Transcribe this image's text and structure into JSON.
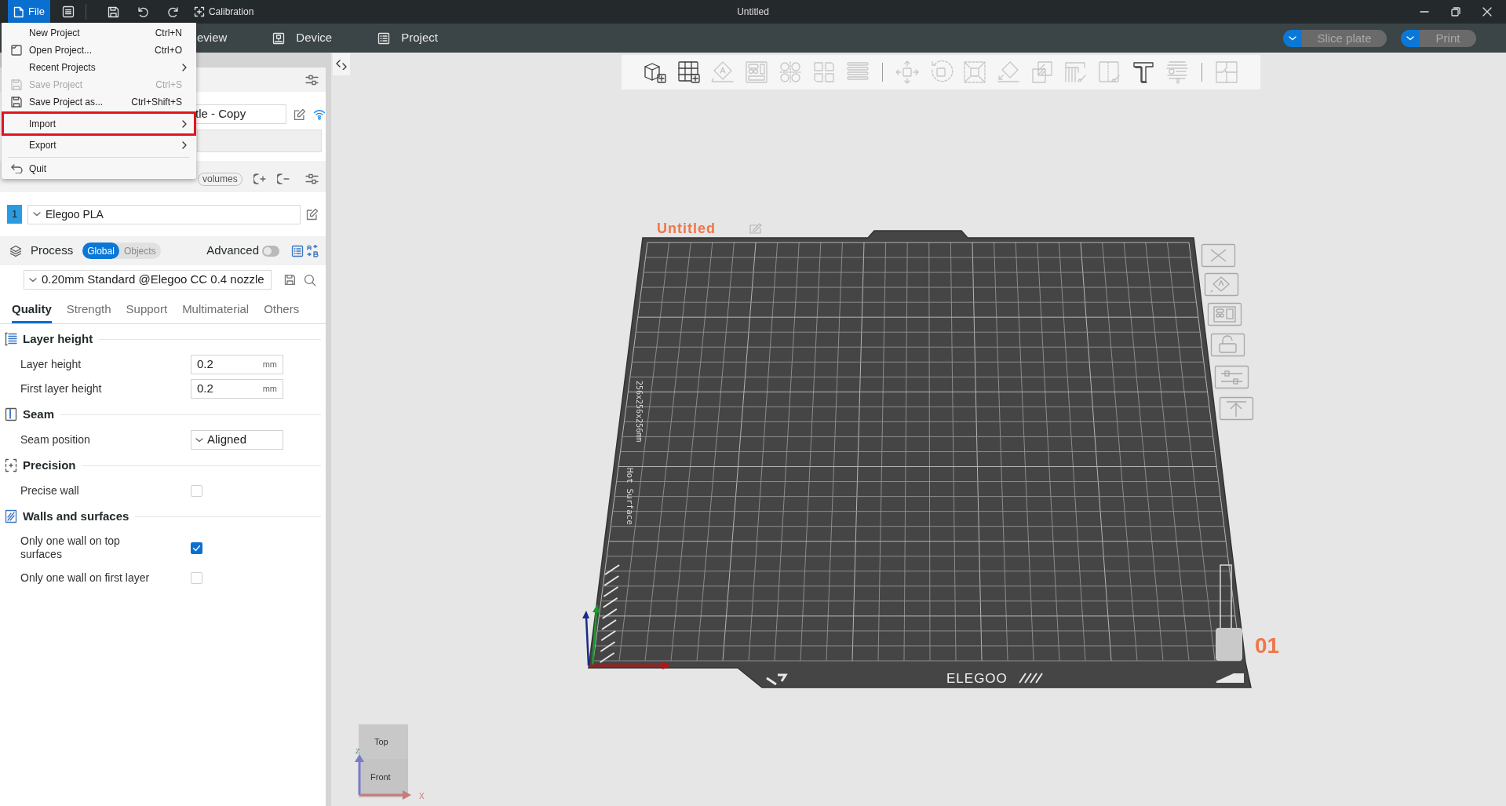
{
  "title_bar": {
    "file_label": "File",
    "calibration_label": "Calibration",
    "title": "Untitled"
  },
  "nav_tabs": [
    {
      "label": "eview",
      "selected": false
    },
    {
      "label": "Device",
      "selected": false
    },
    {
      "label": "Project",
      "selected": false
    }
  ],
  "action_buttons": [
    {
      "label": "Slice plate",
      "disabled": true
    },
    {
      "label": "Print",
      "disabled": true
    }
  ],
  "file_menu": [
    {
      "kind": "item",
      "label": "New Project",
      "shortcut": "Ctrl+N",
      "disabled": false,
      "submenu": false,
      "highlighted": false
    },
    {
      "kind": "item",
      "label": "Open Project...",
      "shortcut": "Ctrl+O",
      "disabled": false,
      "submenu": false,
      "highlighted": false
    },
    {
      "kind": "item",
      "label": "Recent Projects",
      "disabled": false,
      "submenu": true,
      "highlighted": false
    },
    {
      "kind": "item",
      "label": "Save Project",
      "shortcut": "Ctrl+S",
      "disabled": true,
      "submenu": false,
      "highlighted": false
    },
    {
      "kind": "item",
      "label": "Save Project as...",
      "shortcut": "Ctrl+Shift+S",
      "disabled": false,
      "submenu": false,
      "highlighted": false
    },
    {
      "kind": "item",
      "label": "Import",
      "disabled": false,
      "submenu": true,
      "highlighted": true
    },
    {
      "kind": "item",
      "label": "Export",
      "disabled": false,
      "submenu": true,
      "highlighted": false
    },
    {
      "kind": "separator"
    },
    {
      "kind": "item",
      "label": "Quit",
      "disabled": false,
      "submenu": false,
      "highlighted": false
    }
  ],
  "printer": {
    "name": "tle - Copy"
  },
  "filament": {
    "volumes_label": "volumes",
    "slots": [
      {
        "number": "1",
        "name": "Elegoo PLA",
        "color": "#2a9be0"
      }
    ]
  },
  "process": {
    "label": "Process",
    "scopes": [
      {
        "label": "Global",
        "selected": true
      },
      {
        "label": "Objects",
        "selected": false
      }
    ],
    "advanced_label": "Advanced",
    "advanced_on": false,
    "preset": "0.20mm Standard @Elegoo CC 0.4 nozzle",
    "tabs": [
      {
        "label": "Quality",
        "selected": true
      },
      {
        "label": "Strength",
        "selected": false
      },
      {
        "label": "Support",
        "selected": false
      },
      {
        "label": "Multimaterial",
        "selected": false
      },
      {
        "label": "Others",
        "selected": false
      }
    ],
    "sections": [
      {
        "title": "Layer height",
        "rows": [
          {
            "kind": "number",
            "label": "Layer height",
            "value": "0.2",
            "unit": "mm"
          },
          {
            "kind": "number",
            "label": "First layer height",
            "value": "0.2",
            "unit": "mm"
          }
        ]
      },
      {
        "title": "Seam",
        "rows": [
          {
            "kind": "select",
            "label": "Seam position",
            "value": "Aligned"
          }
        ]
      },
      {
        "title": "Precision",
        "rows": [
          {
            "kind": "checkbox",
            "label": "Precise wall",
            "checked": false
          }
        ]
      },
      {
        "title": "Walls and surfaces",
        "rows": [
          {
            "kind": "checkbox",
            "label": "Only one wall on top surfaces",
            "checked": true
          },
          {
            "kind": "checkbox",
            "label": "Only one wall on first layer",
            "checked": false
          }
        ]
      }
    ]
  },
  "plate": {
    "name": "Untitled",
    "number": "01",
    "size_label": "256x256x256mm",
    "surface_label": "Hot Surface",
    "brand": "ELEGOO"
  },
  "view_cube": {
    "top": "Top",
    "front": "Front",
    "z_axis": "Z",
    "x_axis": "X"
  }
}
